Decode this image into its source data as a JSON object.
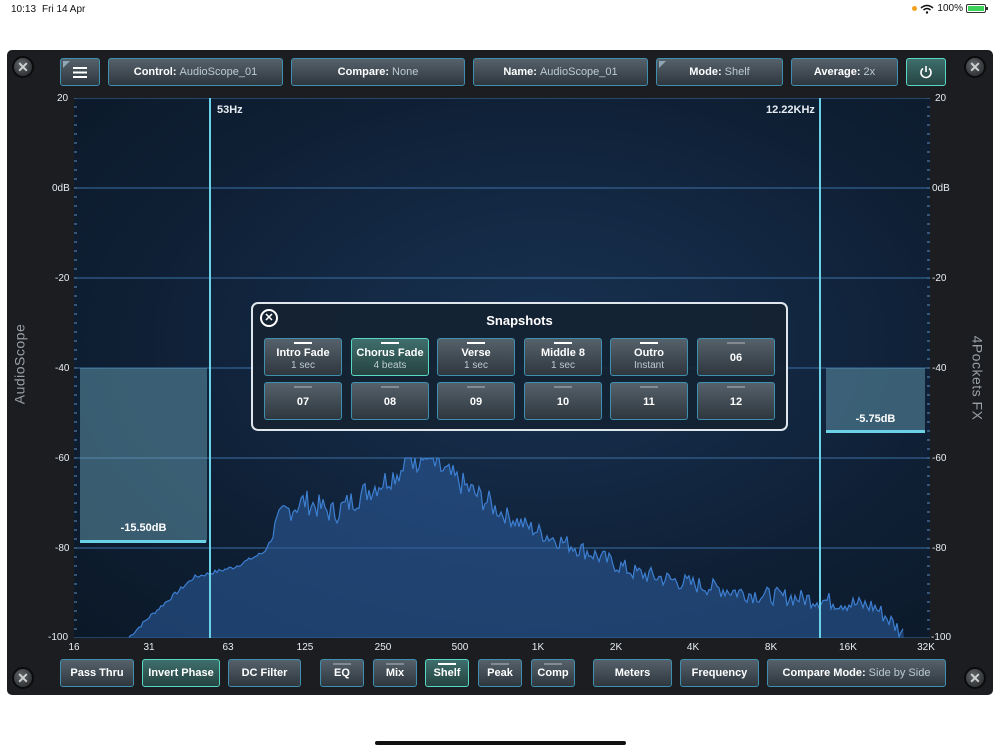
{
  "status_bar": {
    "time": "10:13",
    "date": "Fri 14 Apr",
    "battery": "100%"
  },
  "app": {
    "left_label": "AudioScope",
    "right_label": "4Pockets FX"
  },
  "toolbar": {
    "control_label": "Control:",
    "control_value": "AudioScope_01",
    "compare_label": "Compare:",
    "compare_value": "None",
    "name_label": "Name:",
    "name_value": "AudioScope_01",
    "mode_label": "Mode:",
    "mode_value": "Shelf",
    "average_label": "Average:",
    "average_value": "2x"
  },
  "graph": {
    "y_ticks": [
      "20",
      "0dB",
      "-20",
      "-40",
      "-60",
      "-80",
      "-100"
    ],
    "x_ticks": [
      "16",
      "31",
      "63",
      "125",
      "250",
      "500",
      "1K",
      "2K",
      "4K",
      "8K",
      "16K",
      "32K"
    ],
    "low_cut_label": "53Hz",
    "high_cut_label": "12.22KHz",
    "low_shelf_value": "-15.50dB",
    "high_shelf_value": "-5.75dB",
    "spectrum_color": "#3d7fd1"
  },
  "snapshots": {
    "title": "Snapshots",
    "items": [
      {
        "name": "Intro Fade",
        "sub": "1 sec",
        "filled": true,
        "active": false
      },
      {
        "name": "Chorus Fade",
        "sub": "4 beats",
        "filled": true,
        "active": true
      },
      {
        "name": "Verse",
        "sub": "1 sec",
        "filled": true,
        "active": false
      },
      {
        "name": "Middle 8",
        "sub": "1 sec",
        "filled": true,
        "active": false
      },
      {
        "name": "Outro",
        "sub": "Instant",
        "filled": true,
        "active": false
      },
      {
        "name": "06",
        "sub": "",
        "filled": false,
        "active": false
      },
      {
        "name": "07",
        "sub": "",
        "filled": false,
        "active": false
      },
      {
        "name": "08",
        "sub": "",
        "filled": false,
        "active": false
      },
      {
        "name": "09",
        "sub": "",
        "filled": false,
        "active": false
      },
      {
        "name": "10",
        "sub": "",
        "filled": false,
        "active": false
      },
      {
        "name": "11",
        "sub": "",
        "filled": false,
        "active": false
      },
      {
        "name": "12",
        "sub": "",
        "filled": false,
        "active": false
      }
    ]
  },
  "bottom_bar": {
    "pass_thru": "Pass Thru",
    "invert_phase": "Invert Phase",
    "dc_filter": "DC Filter",
    "eq": "EQ",
    "mix": "Mix",
    "shelf": "Shelf",
    "peak": "Peak",
    "comp": "Comp",
    "meters": "Meters",
    "frequency": "Frequency",
    "compare_mode_label": "Compare Mode:",
    "compare_mode_value": "Side by Side"
  }
}
